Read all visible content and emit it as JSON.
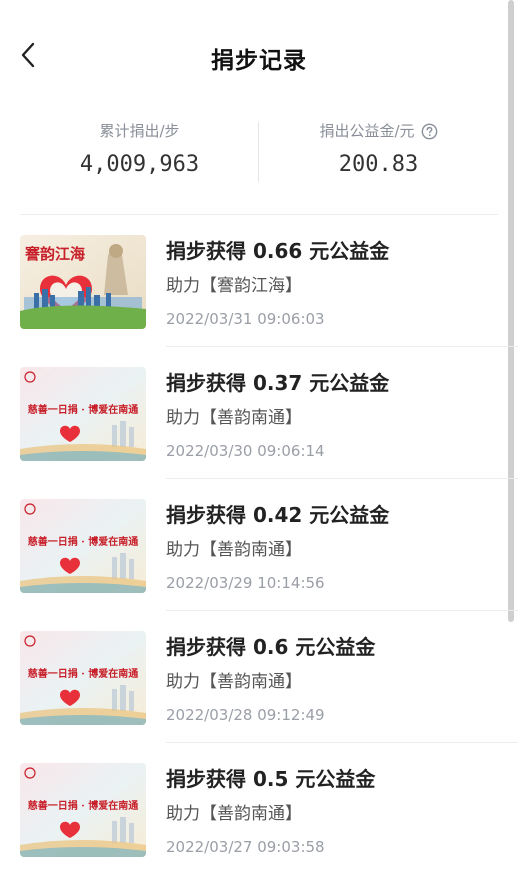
{
  "header": {
    "title": "捐步记录"
  },
  "stats": {
    "total_steps_label": "累计捐出/步",
    "total_steps_value": "4,009,963",
    "total_money_label": "捐出公益金/元",
    "total_money_value": "200.83"
  },
  "records": [
    {
      "title": "捐步获得 0.66 元公益金",
      "project": "助力【謇韵江海】",
      "time": "2022/03/31 09:06:03",
      "image": "謇韵江海",
      "image_variant": "jianyun"
    },
    {
      "title": "捐步获得 0.37 元公益金",
      "project": "助力【善韵南通】",
      "time": "2022/03/30 09:06:14",
      "image": "慈善一日捐 · 博爱在南通",
      "image_variant": "shanyun"
    },
    {
      "title": "捐步获得 0.42 元公益金",
      "project": "助力【善韵南通】",
      "time": "2022/03/29 10:14:56",
      "image": "慈善一日捐 · 博爱在南通",
      "image_variant": "shanyun"
    },
    {
      "title": "捐步获得 0.6 元公益金",
      "project": "助力【善韵南通】",
      "time": "2022/03/28 09:12:49",
      "image": "慈善一日捐 · 博爱在南通",
      "image_variant": "shanyun"
    },
    {
      "title": "捐步获得 0.5 元公益金",
      "project": "助力【善韵南通】",
      "time": "2022/03/27 09:03:58",
      "image": "慈善一日捐 · 博爱在南通",
      "image_variant": "shanyun"
    }
  ],
  "icons": {
    "back": "chevron-left-icon",
    "help": "question-circle-icon"
  },
  "colors": {
    "title": "#111111",
    "label": "#8a8f99",
    "muted": "#9a9ea6",
    "heart_red": "#e8303a"
  }
}
